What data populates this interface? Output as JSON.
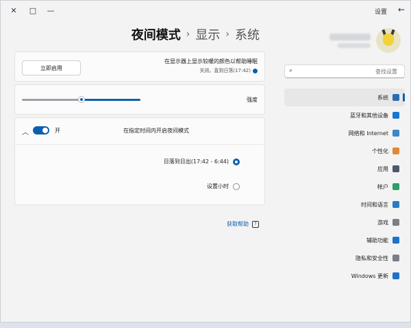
{
  "titlebar": {
    "title": "设置",
    "minimize_glyph": "—",
    "maximize_glyph": "□",
    "close_glyph": "✕",
    "back_glyph": "←"
  },
  "breadcrumb": {
    "items": [
      "系统",
      "显示",
      "夜间模式"
    ],
    "separator": "›"
  },
  "night_light": {
    "turn_on_now_label": "立即启用",
    "description": "在显示器上显示较暖的颜色以帮助睡眠",
    "status": "关闭。直到日落(17:42)",
    "strength_label": "强度",
    "strength_value": 0.5,
    "schedule_label": "在指定时间内开启夜间模式",
    "toggle_label": "开",
    "toggle_on": true,
    "options": [
      {
        "label": "日落到日出(17:42 - 6:44)",
        "selected": true
      },
      {
        "label": "设置小时",
        "selected": false
      }
    ]
  },
  "help": {
    "label": "获取帮助"
  },
  "search": {
    "placeholder": "查找设置"
  },
  "sidebar": {
    "items": [
      {
        "label": "系统",
        "icon": "system-icon",
        "color": "#2b6cb0",
        "active": true
      },
      {
        "label": "蓝牙和其他设备",
        "icon": "bluetooth-icon",
        "color": "#1976d2",
        "active": false
      },
      {
        "label": "网络和 Internet",
        "icon": "network-icon",
        "color": "#3b88c8",
        "active": false
      },
      {
        "label": "个性化",
        "icon": "brush-icon",
        "color": "#e0883a",
        "active": false
      },
      {
        "label": "应用",
        "icon": "apps-icon",
        "color": "#4a5a6a",
        "active": false
      },
      {
        "label": "帐户",
        "icon": "account-icon",
        "color": "#2e9e6a",
        "active": false
      },
      {
        "label": "时间和语言",
        "icon": "time-language-icon",
        "color": "#2a7cc4",
        "active": false
      },
      {
        "label": "游戏",
        "icon": "gaming-icon",
        "color": "#7a7f86",
        "active": false
      },
      {
        "label": "辅助功能",
        "icon": "accessibility-icon",
        "color": "#1e73c8",
        "active": false
      },
      {
        "label": "隐私和安全性",
        "icon": "shield-icon",
        "color": "#7a7f86",
        "active": false
      },
      {
        "label": "Windows 更新",
        "icon": "update-icon",
        "color": "#1e73c8",
        "active": false
      }
    ]
  }
}
